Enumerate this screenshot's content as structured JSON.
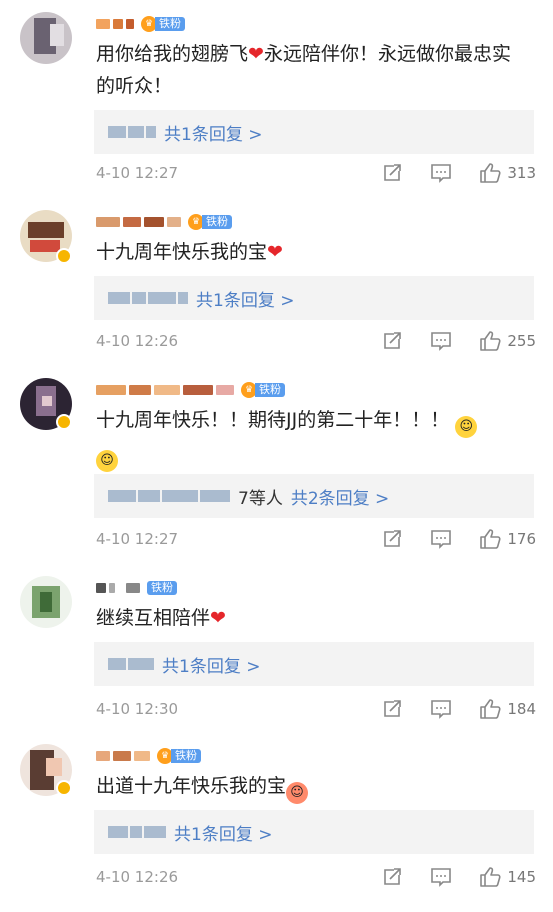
{
  "comments": [
    {
      "name": "",
      "badge": "铁粉",
      "text": "用你给我的翅膀飞",
      "text2": "永远陪伴你！永远做你最忠实的听众！",
      "reply_prefix": "",
      "reply_link": "共1条回复 >",
      "time": "4-10 12:27",
      "likes": "313"
    },
    {
      "name": "",
      "badge": "铁粉",
      "text": "十九周年快乐我的宝",
      "text2": "",
      "reply_prefix": "",
      "reply_link": "共1条回复 >",
      "time": "4-10 12:26",
      "likes": "255"
    },
    {
      "name": "",
      "badge": "铁粉",
      "text": "十九周年快乐！！期待JJ的第二十年！！！",
      "text2": "",
      "reply_prefix": "7等人",
      "reply_link": "共2条回复 >",
      "time": "4-10 12:27",
      "likes": "176"
    },
    {
      "name": "",
      "badge": "铁粉",
      "text": "继续互相陪伴",
      "text2": "",
      "reply_prefix": "",
      "reply_link": "共1条回复 >",
      "time": "4-10 12:30",
      "likes": "184"
    },
    {
      "name": "",
      "badge": "铁粉",
      "text": "出道十九年快乐我的宝",
      "text2": "",
      "reply_prefix": "",
      "reply_link": "共1条回复 >",
      "time": "4-10 12:26",
      "likes": "145"
    }
  ],
  "icons": {
    "repost": "repost-icon",
    "comment": "comment-icon",
    "like": "like-icon",
    "heart": "heart-emoji",
    "emoji": "emoji-icon"
  },
  "colors": {
    "link": "#4d7ec5",
    "heart": "#e5262b",
    "badge": "#5a9dee"
  }
}
